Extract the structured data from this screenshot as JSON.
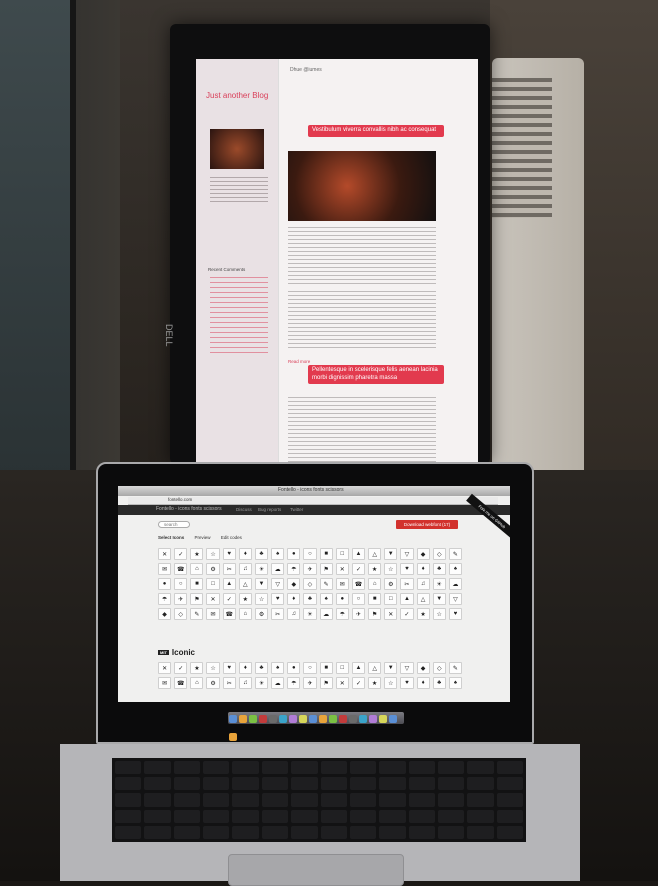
{
  "scene": {
    "description_type": "photo",
    "monitor": {
      "blog_title": "Just another Blog",
      "author": "Dhue @iumes",
      "recent_comments": "Recent Comments",
      "post1_title": "Vestibulum viverra convallis nibh ac consequat",
      "post2_title": "Pellentesque in scelerisque felis aenean lacinia morbi dignissim pharetra massa",
      "read_more": "Read more",
      "brand": "DELL"
    },
    "laptop": {
      "window_title": "Fontello - icons fonts scissors",
      "url": "fontello.com",
      "site_logo": "Fontello - icons fonts scissors",
      "nav_items": [
        "Discuss",
        "Bug reports",
        "Twitter"
      ],
      "search_placeholder": "search",
      "download_button": "Download webfont (17)",
      "ribbon": "Fork me on GitHub",
      "tabs": [
        "Select Icons",
        "Preview",
        "Edit codes"
      ],
      "section_title": "Iconic",
      "section_tag": "MIT"
    }
  }
}
